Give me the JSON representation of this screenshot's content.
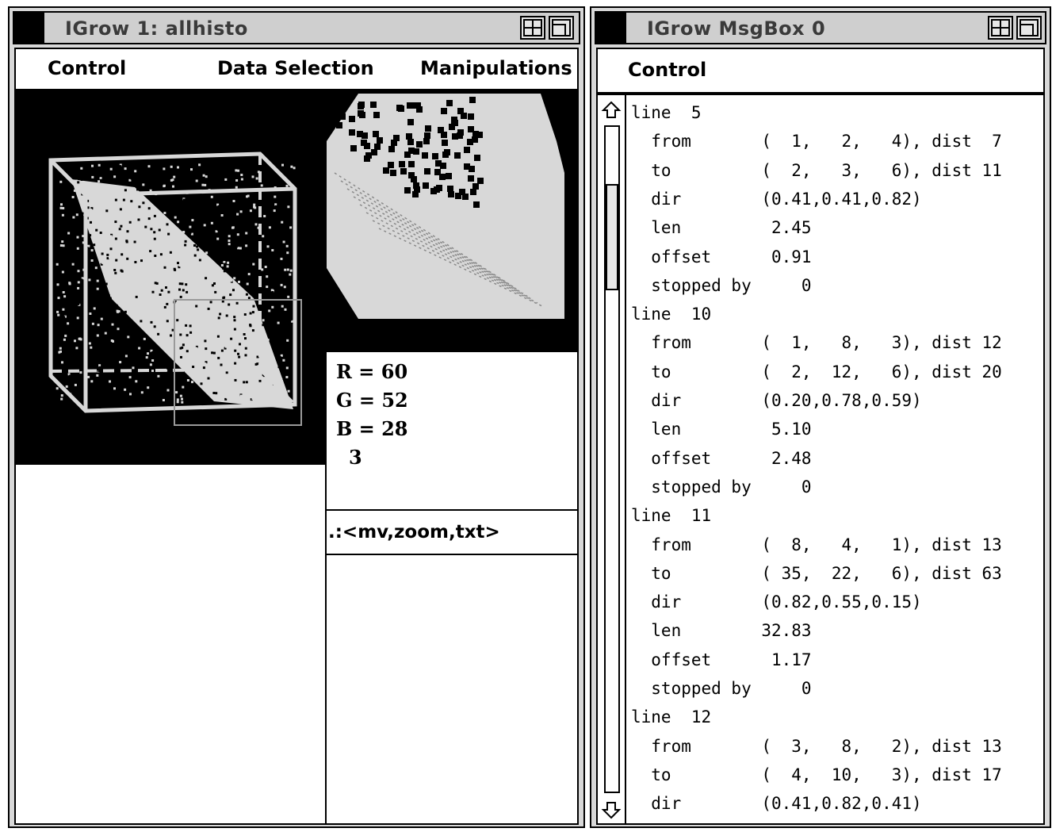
{
  "window1": {
    "title": "IGrow 1: allhisto",
    "menu": [
      "Control",
      "Data Selection",
      "Manipulations"
    ],
    "rgb": {
      "r": "R = 60",
      "g": "G = 52",
      "b": "B = 28",
      "count": "3"
    },
    "command_hint": ".:<mv,zoom,txt>"
  },
  "window2": {
    "title": "IGrow MsgBox 0",
    "menu": [
      "Control"
    ],
    "messages": [
      "line  5",
      "  from       (  1,   2,   4), dist  7",
      "  to         (  2,   3,   6), dist 11",
      "  dir        (0.41,0.41,0.82)",
      "  len         2.45",
      "  offset      0.91",
      "  stopped by     0",
      "line  10",
      "  from       (  1,   8,   3), dist 12",
      "  to         (  2,  12,   6), dist 20",
      "  dir        (0.20,0.78,0.59)",
      "  len         5.10",
      "  offset      2.48",
      "  stopped by     0",
      "line  11",
      "  from       (  8,   4,   1), dist 13",
      "  to         ( 35,  22,   6), dist 63",
      "  dir        (0.82,0.55,0.15)",
      "  len        32.83",
      "  offset      1.17",
      "  stopped by     0",
      "line  12",
      "  from       (  3,   8,   2), dist 13",
      "  to         (  4,  10,   3), dist 17",
      "  dir        (0.41,0.82,0.41)"
    ]
  },
  "colors": {
    "frame": "#d8d8d8",
    "title_bg": "#cfcfcf",
    "title_text": "#3a3a3a",
    "canvas": "#000000",
    "points": "#d8d8d8"
  },
  "icons": [
    "resize-icon",
    "maximize-icon",
    "scroll-up-arrow-icon",
    "scroll-down-arrow-icon"
  ]
}
